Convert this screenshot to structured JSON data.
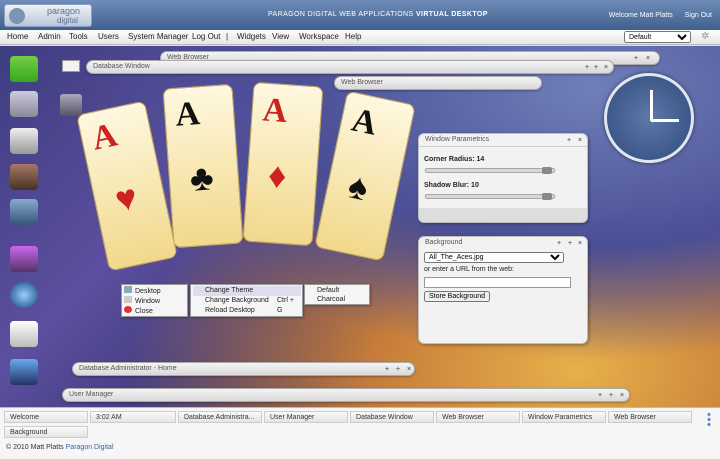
{
  "header": {
    "logo_line1": "paragon",
    "logo_line2": "digital",
    "tagline_pre": "PARAGON DIGITAL WEB APPLICATIONS",
    "tagline_bold": "VIRTUAL DESKTOP",
    "welcome": "Welcome Matt Platts",
    "signout": "Sign Out"
  },
  "menu": {
    "items": [
      "Home",
      "Admin",
      "Tools",
      "Users",
      "System Manager",
      "Log Out",
      "|",
      "Widgets",
      "View",
      "Workspace",
      "Help"
    ],
    "theme_selected": "Default"
  },
  "windows": {
    "welcome": "Welcome",
    "web_browser_1": "Web Browser",
    "database_window": "Database Window",
    "web_browser_2": "Web Browser",
    "window_parametrics": {
      "title": "Window Parametrics",
      "corner_label": "Corner Radius: 14",
      "blur_label": "Shadow Blur: 10"
    },
    "background": {
      "title": "Background",
      "selected": "All_The_Aces.jpg",
      "url_label": "or enter a URL from the web:",
      "button": "Store Background"
    },
    "db_admin": "Database Administrator - Home",
    "user_manager": "User Manager"
  },
  "context_menu": {
    "level1": [
      "Desktop",
      "Window",
      "Close"
    ],
    "level2": [
      "Change Theme",
      "Change Background",
      "Reload Desktop"
    ],
    "level2_shortcut": "Ctrl + G",
    "level3": [
      "Default",
      "Charcoal"
    ]
  },
  "cards": [
    "A",
    "A",
    "A",
    "A"
  ],
  "taskbar": [
    "Welcome",
    "3:02 AM",
    "Database Administra...",
    "User Manager",
    "Database Window",
    "Web Browser",
    "Window Parametrics",
    "Web Browser",
    "Background"
  ],
  "footer": {
    "copyright": "© 2010 Matt Platts",
    "link": "Paragon Digital"
  },
  "colors": {
    "accent": "#3f5f8e",
    "close_red": "#d33"
  }
}
